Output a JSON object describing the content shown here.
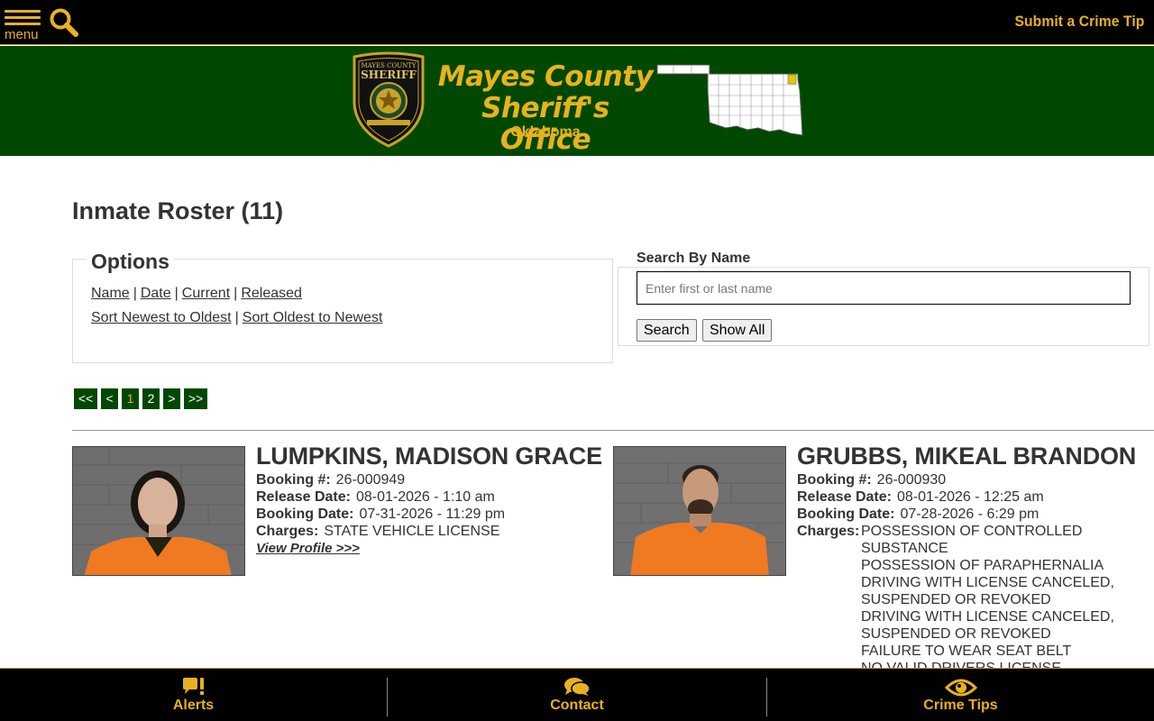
{
  "topbar": {
    "menu_label": "menu",
    "crime_tip_label": "Submit a Crime Tip",
    "accent_color": "#e8b21e"
  },
  "banner": {
    "title_line1": "Mayes County",
    "title_line2": "Sheriff's Office",
    "subtitle": "Oklahoma",
    "badge_text_top": "MAYES COUNTY",
    "badge_text_main": "SHERIFF",
    "background_color": "#004800"
  },
  "page": {
    "title": "Inmate Roster (11)"
  },
  "options": {
    "legend": "Options",
    "filter_links": [
      "Name",
      "Date",
      "Current",
      "Released"
    ],
    "sort_links": [
      "Sort Newest to Oldest",
      "Sort Oldest to Newest"
    ],
    "separator": "|"
  },
  "search": {
    "legend": "Search By Name",
    "placeholder": "Enter first or last name",
    "value": "",
    "search_button": "Search",
    "show_all_button": "Show All"
  },
  "pagination": {
    "first": "<<",
    "prev": "<",
    "pages": [
      "1",
      "2"
    ],
    "current_page": "1",
    "next": ">",
    "last": ">>"
  },
  "inmates": [
    {
      "name": "LUMPKINS, MADISON GRACE",
      "booking_label": "Booking #:",
      "booking_number": "26-000949",
      "release_label": "Release Date:",
      "release_date": "08-01-2026 - 1:10 am",
      "booking_date_label": "Booking Date:",
      "booking_date": "07-31-2026 - 11:29 pm",
      "charges_label": "Charges:",
      "charges": [
        "STATE VEHICLE LICENSE"
      ],
      "view_profile": "View Profile >>>"
    },
    {
      "name": "GRUBBS, MIKEAL BRANDON",
      "booking_label": "Booking #:",
      "booking_number": "26-000930",
      "release_label": "Release Date:",
      "release_date": "08-01-2026 - 12:25 am",
      "booking_date_label": "Booking Date:",
      "booking_date": "07-28-2026 - 6:29 pm",
      "charges_label": "Charges:",
      "charges": [
        "POSSESSION OF CONTROLLED",
        "SUBSTANCE",
        "POSSESSION OF PARAPHERNALIA",
        "DRIVING WITH LICENSE CANCELED,",
        "SUSPENDED OR REVOKED",
        "DRIVING WITH LICENSE CANCELED,",
        "SUSPENDED OR REVOKED",
        "FAILURE TO WEAR SEAT BELT",
        "NO VALID DRIVERS LICENSE"
      ]
    }
  ],
  "bottom_nav": {
    "alerts": "Alerts",
    "contact": "Contact",
    "crime_tips": "Crime Tips",
    "icons": [
      "alert-chat-icon",
      "chat-bubbles-icon",
      "eye-icon"
    ]
  }
}
